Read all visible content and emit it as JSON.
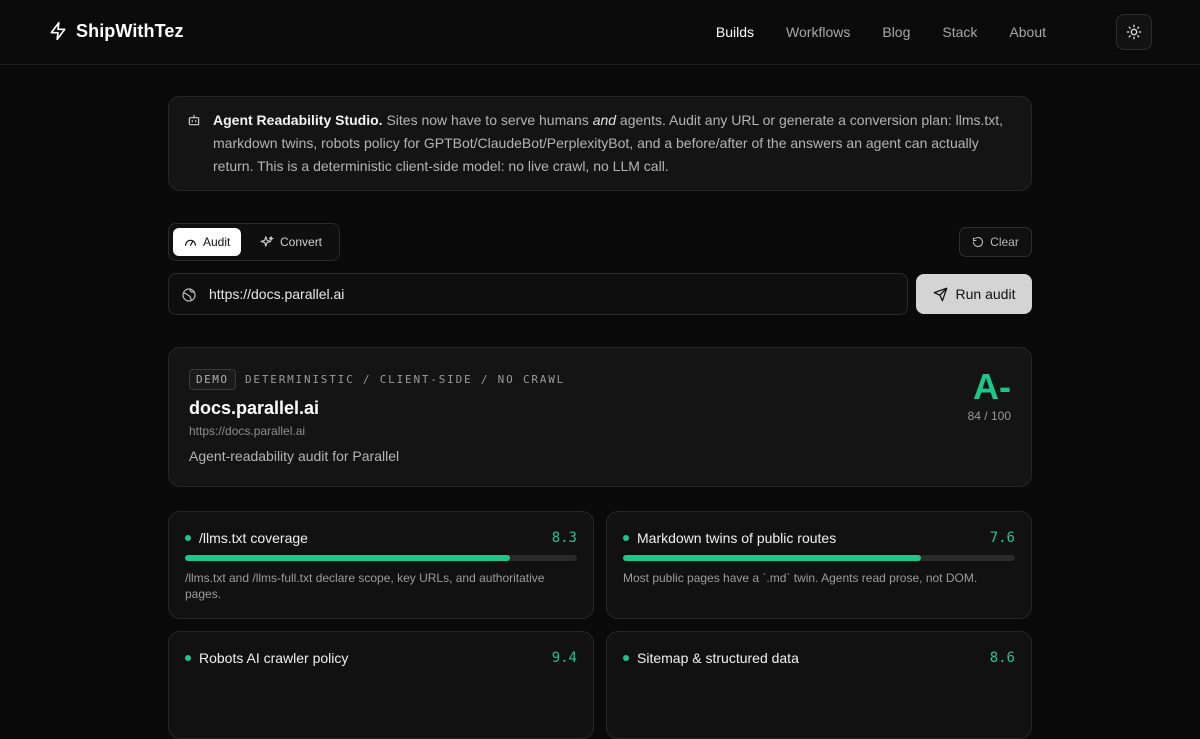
{
  "header": {
    "brand": "ShipWithTez",
    "nav": [
      "Builds",
      "Workflows",
      "Blog",
      "Stack",
      "About"
    ],
    "active_nav": "Builds",
    "icons": {
      "brand": "bolt-icon",
      "theme": "sun-icon"
    }
  },
  "banner": {
    "title": "Agent Readability Studio.",
    "text_before_em": " Sites now have to serve humans ",
    "em": "and",
    "text_after_em": " agents. Audit any URL or generate a conversion plan: llms.txt, markdown twins, robots policy for GPTBot/ClaudeBot/PerplexityBot, and a before/after of the answers an agent can actually return. This is a deterministic client-side model: no live crawl, no LLM call."
  },
  "modes": {
    "audit": "Audit",
    "convert": "Convert",
    "selected": "Audit"
  },
  "clear_label": "Clear",
  "url_input": {
    "value": "https://docs.parallel.ai"
  },
  "run_label": "Run audit",
  "result": {
    "badge": "DEMO",
    "tag": "DETERMINISTIC / CLIENT-SIDE / NO CRAWL",
    "site": "docs.parallel.ai",
    "url": "https://docs.parallel.ai",
    "description": "Agent-readability audit for Parallel",
    "grade": "A-",
    "score": "84 / 100"
  },
  "metrics": [
    {
      "name": "/llms.txt coverage",
      "score": "8.3",
      "fraction": 0.83,
      "description": "/llms.txt and /llms-full.txt declare scope, key URLs, and authoritative pages."
    },
    {
      "name": "Markdown twins of public routes",
      "score": "7.6",
      "fraction": 0.76,
      "description": "Most public pages have a `.md` twin. Agents read prose, not DOM."
    },
    {
      "name": "Robots AI crawler policy",
      "score": "9.4",
      "fraction": 0.94,
      "description": ""
    },
    {
      "name": "Sitemap & structured data",
      "score": "8.6",
      "fraction": 0.86,
      "description": ""
    }
  ],
  "colors": {
    "accent": "#1fc68b",
    "background": "#0a0a0a",
    "card": "#141414"
  }
}
